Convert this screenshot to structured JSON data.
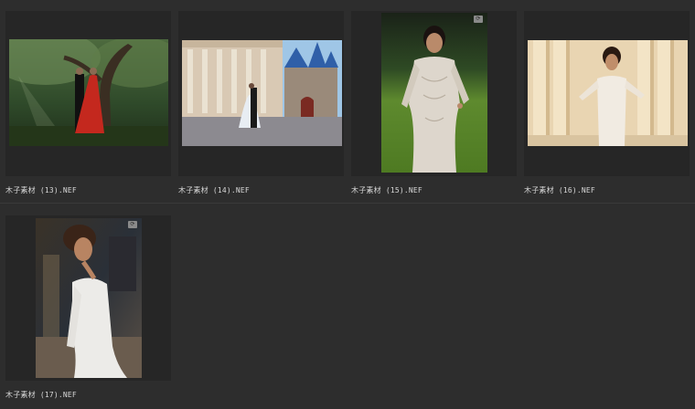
{
  "files": [
    {
      "filename": "木子素材 (13).NEF",
      "rotate_badge": false
    },
    {
      "filename": "木子素材 (14).NEF",
      "rotate_badge": false
    },
    {
      "filename": "木子素材 (15).NEF",
      "rotate_badge": true
    },
    {
      "filename": "木子素材 (16).NEF",
      "rotate_badge": false
    },
    {
      "filename": "木子素材 (17).NEF",
      "rotate_badge": true
    }
  ],
  "badge_icon": "rotate-icon",
  "colors": {
    "background": "#2d2d2d",
    "tile": "#262626",
    "caption": "#d8d8d8"
  }
}
